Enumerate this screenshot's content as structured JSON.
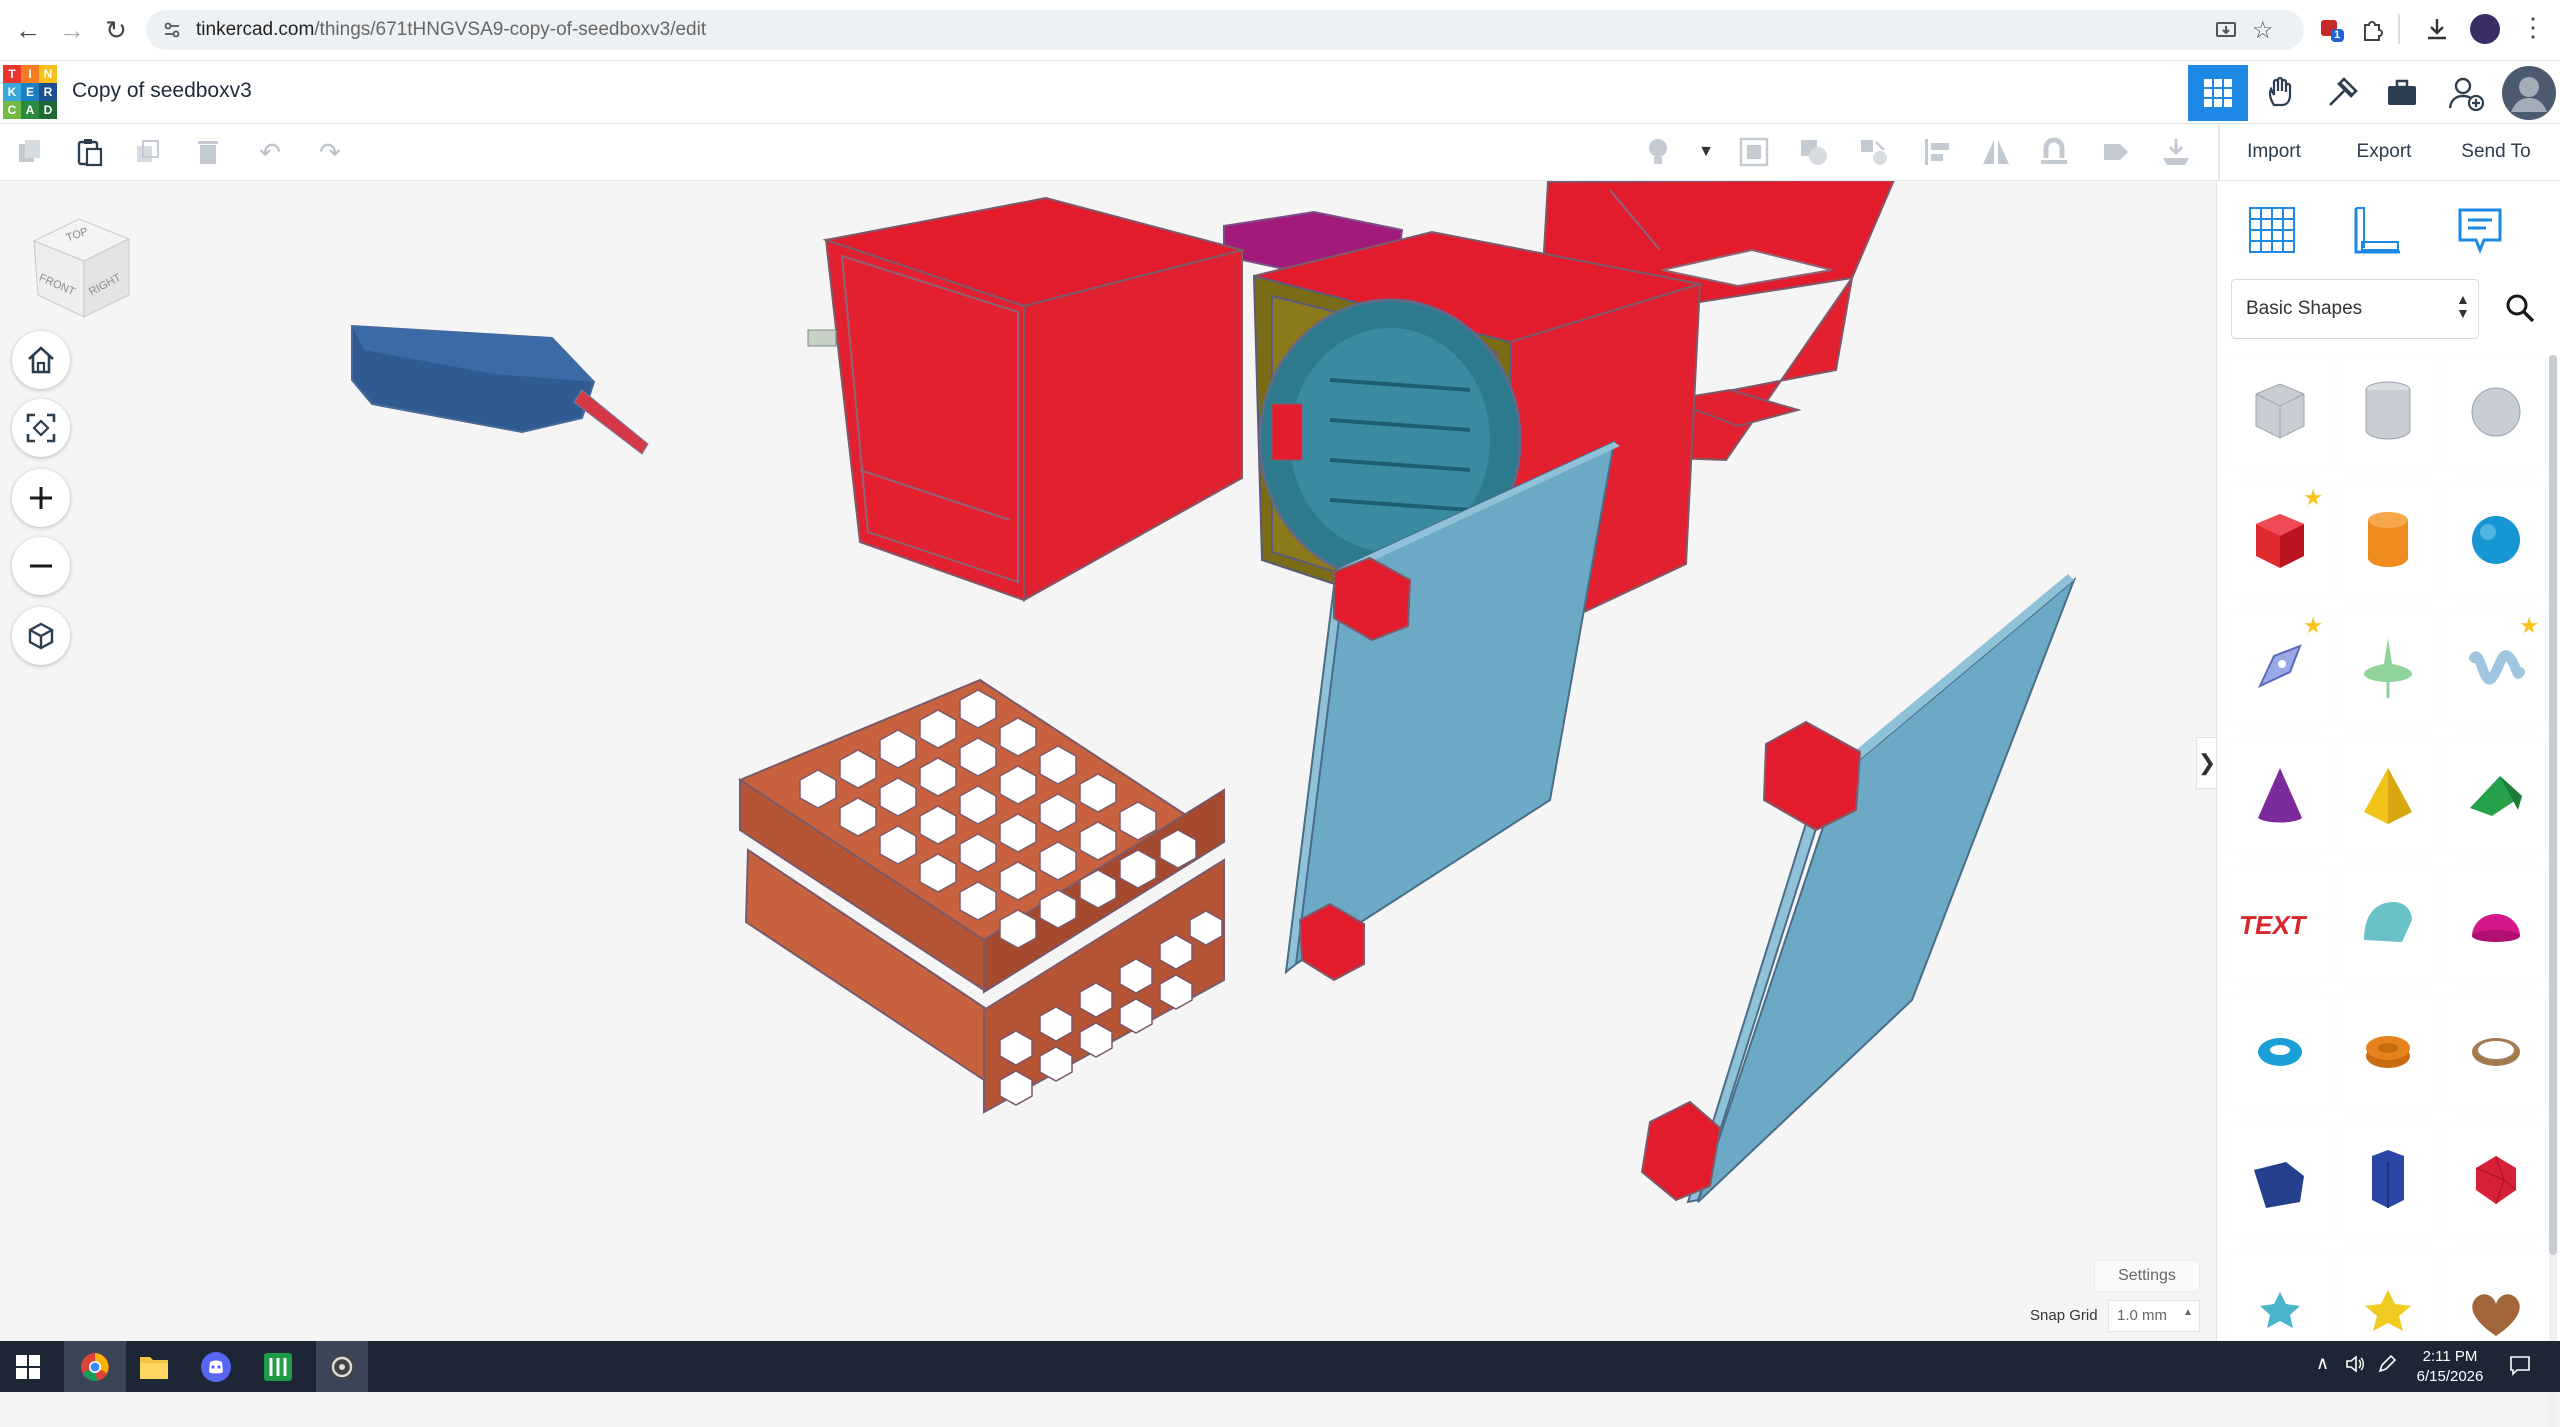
{
  "browser": {
    "url_host": "tinkercad.com",
    "url_path": "/things/671tHNGVSA9-copy-of-seedboxv3/edit",
    "extension_badge": "1"
  },
  "app": {
    "logo_letters": [
      "T",
      "I",
      "N",
      "K",
      "E",
      "R",
      "C",
      "A",
      "D"
    ],
    "logo_colors": [
      "#e8362d",
      "#f37b22",
      "#f7c11b",
      "#38a8db",
      "#1b7fc1",
      "#1d4e8f",
      "#76b947",
      "#2a8a3e",
      "#1d6b34"
    ],
    "design_title": "Copy of seedboxv3",
    "accent": "#1e88e5"
  },
  "toolbar": {
    "import_label": "Import",
    "export_label": "Export",
    "send_to_label": "Send To"
  },
  "view_cube": {
    "top": "TOP",
    "front": "FRONT",
    "right": "RIGHT"
  },
  "panel": {
    "category": "Basic Shapes",
    "shapes": [
      {
        "name": "box-striped",
        "color": "#c9ced4"
      },
      {
        "name": "cylinder-striped",
        "color": "#c9ced4"
      },
      {
        "name": "sphere-striped",
        "color": "#c9ced4"
      },
      {
        "name": "box",
        "color": "#e02a2f"
      },
      {
        "name": "cylinder",
        "color": "#f08c1e"
      },
      {
        "name": "sphere",
        "color": "#1696d2"
      },
      {
        "name": "scribble",
        "color": "#9aa9e6"
      },
      {
        "name": "paraboloid",
        "color": "#8fd39a"
      },
      {
        "name": "shape-generator",
        "color": "#9fc5e0"
      },
      {
        "name": "cone",
        "color": "#7a2a9a"
      },
      {
        "name": "pyramid",
        "color": "#f2c318"
      },
      {
        "name": "roof",
        "color": "#26a14a"
      },
      {
        "name": "text",
        "color": "#d7262d"
      },
      {
        "name": "half-cylinder",
        "color": "#69c2c8"
      },
      {
        "name": "half-sphere",
        "color": "#d6178a"
      },
      {
        "name": "torus",
        "color": "#1aa0d6"
      },
      {
        "name": "tube",
        "color": "#e5821d"
      },
      {
        "name": "ring",
        "color": "#a47a51"
      },
      {
        "name": "polygon",
        "color": "#243f8c"
      },
      {
        "name": "hexagonal-prism",
        "color": "#2a47a5"
      },
      {
        "name": "icosahedron",
        "color": "#d71f35"
      },
      {
        "name": "star",
        "color": "#4bb4cc"
      },
      {
        "name": "star-yellow",
        "color": "#f0cc20"
      },
      {
        "name": "heart",
        "color": "#a3663a"
      }
    ]
  },
  "viewport": {
    "settings_label": "Settings",
    "snap_grid_label": "Snap Grid",
    "snap_grid_value": "1.0 mm"
  },
  "taskbar": {
    "time": "2:11 PM",
    "date": "6/15/2026"
  }
}
